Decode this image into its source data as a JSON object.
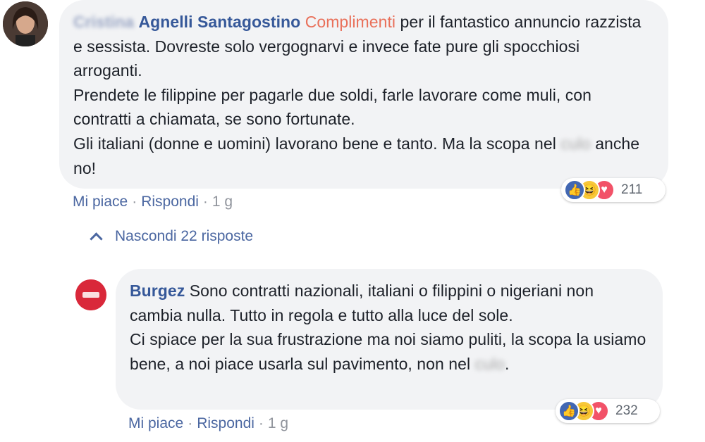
{
  "comment": {
    "author": "Cristina Agnelli Santagostino",
    "author_blurred_part": "Cristina",
    "author_visible_part": "Agnelli Santagostino",
    "highlight": "Complimenti",
    "text_line1": "per il fantastico",
    "text_rest": "annuncio razzista e sessista. Dovreste solo vergognarvi e invece fate pure gli spocchiosi arroganti.",
    "text_p2": "Prendete le filippine per pagarle due soldi, farle lavorare come muli, con contratti a chiamata, se sono fortunate.",
    "text_p3": "Gli italiani (donne e uomini) lavorano bene e tanto. Ma la scopa nel",
    "text_blurred": "culo",
    "text_end": "anche no!",
    "like_label": "Mi piace",
    "reply_label": "Rispondi",
    "time": "1 g",
    "reaction_count": "211"
  },
  "replies_toggle": {
    "label": "Nascondi 22 risposte"
  },
  "reply": {
    "author": "Burgez",
    "text_p1": "Sono contratti nazionali, italiani o filippini o nigeriani non cambia nulla. Tutto in regola e tutto alla luce del sole.",
    "text_p2": "Ci spiace per la sua frustrazione ma noi siamo puliti, la scopa la usiamo bene, a noi piace usarla sul pavimento, non nel",
    "text_blurred": "culo",
    "text_end": ".",
    "like_label": "Mi piace",
    "reply_label": "Rispondi",
    "time": "1 g",
    "reaction_count": "232"
  },
  "reaction_icons": [
    "like-icon",
    "haha-icon",
    "love-icon"
  ],
  "colors": {
    "bubble": "#f2f3f5",
    "link": "#4b67a1",
    "author": "#365899",
    "highlight": "#e9705a",
    "like": "#4267b2",
    "haha": "#f7c83a",
    "love": "#f25268"
  }
}
